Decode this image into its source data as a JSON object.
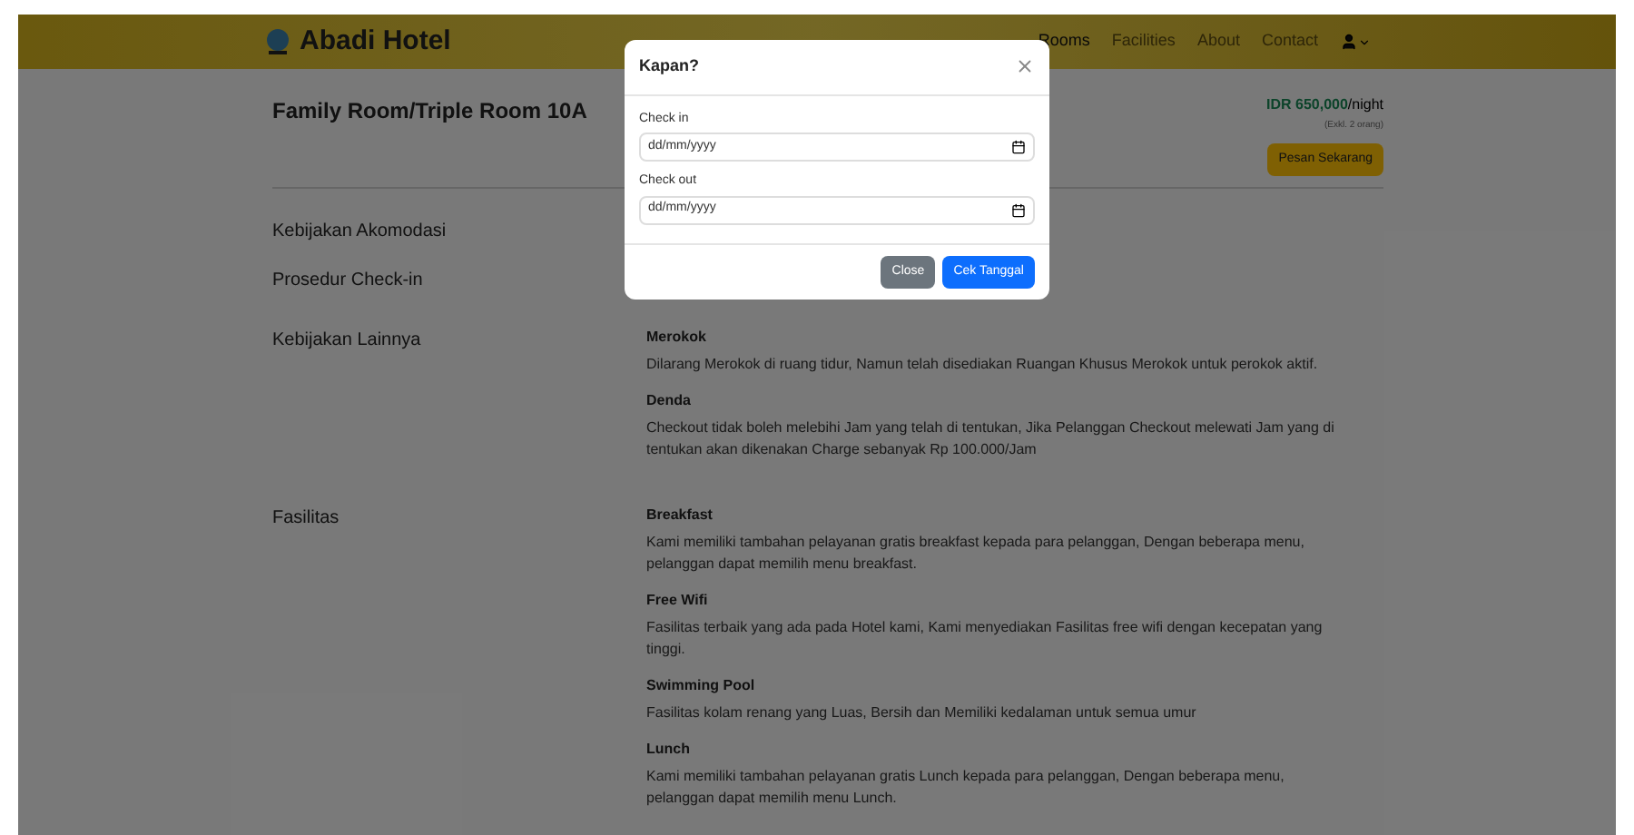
{
  "navbar": {
    "brand": "Abadi Hotel",
    "links": [
      {
        "label": "Rooms",
        "selected": true
      },
      {
        "label": "Facilities",
        "selected": false
      },
      {
        "label": "About",
        "selected": false
      },
      {
        "label": "Contact",
        "selected": false
      }
    ]
  },
  "room": {
    "title": "Family Room/Triple Room 10A",
    "price": "IDR 650,000",
    "unit": "/night",
    "note": "(Exkl. 2 orang)",
    "book_button": "Pesan Sekarang"
  },
  "sections": [
    {
      "heading": "Kebijakan Akomodasi"
    },
    {
      "heading": "Prosedur Check-in"
    },
    {
      "heading": "Kebijakan Lainnya",
      "items": [
        {
          "title": "Merokok",
          "text": "Dilarang Merokok di ruang tidur, Namun telah disediakan Ruangan Khusus Merokok untuk perokok aktif."
        },
        {
          "title": "Denda",
          "text": "Checkout tidak boleh melebihi Jam yang telah di tentukan, Jika Pelanggan Checkout melewati Jam yang di tentukan akan dikenakan Charge sebanyak Rp 100.000/Jam"
        }
      ]
    },
    {
      "heading": "Fasilitas",
      "items": [
        {
          "title": "Breakfast",
          "text": "Kami memiliki tambahan pelayanan gratis breakfast kepada para pelanggan, Dengan beberapa menu, pelanggan dapat memilih menu breakfast."
        },
        {
          "title": "Free Wifi",
          "text": "Fasilitas terbaik yang ada pada Hotel kami, Kami menyediakan Fasilitas free wifi dengan kecepatan yang tinggi."
        },
        {
          "title": "Swimming Pool",
          "text": "Fasilitas kolam renang yang Luas, Bersih dan Memiliki kedalaman untuk semua umur"
        },
        {
          "title": "Lunch",
          "text": "Kami memiliki tambahan pelayanan gratis Lunch kepada para pelanggan, Dengan beberapa menu, pelanggan dapat memilih menu Lunch."
        }
      ]
    }
  ],
  "modal": {
    "title": "Kapan?",
    "fields": [
      {
        "label": "Check in",
        "placeholder": "dd/mm/yyyy"
      },
      {
        "label": "Check out",
        "placeholder": "dd/mm/yyyy"
      }
    ],
    "buttons": [
      {
        "label": "Close",
        "kind": "secondary"
      },
      {
        "label": "Cek Tanggal",
        "kind": "primary"
      }
    ]
  }
}
